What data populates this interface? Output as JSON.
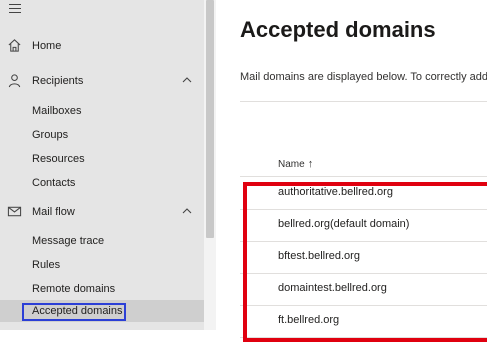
{
  "sidebar": {
    "items": [
      {
        "label": "Home",
        "icon": "home-icon"
      },
      {
        "label": "Recipients",
        "icon": "person-icon",
        "expanded": true,
        "children": [
          "Mailboxes",
          "Groups",
          "Resources",
          "Contacts"
        ]
      },
      {
        "label": "Mail flow",
        "icon": "mail-icon",
        "expanded": true,
        "children": [
          "Message trace",
          "Rules",
          "Remote domains",
          "Accepted domains"
        ]
      }
    ],
    "active": "Accepted domains"
  },
  "main": {
    "title": "Accepted domains",
    "description": "Mail domains are displayed below. To correctly add do",
    "table": {
      "columns": [
        {
          "label": "Name",
          "sort": "ascending"
        }
      ],
      "rows": [
        "authoritative.bellred.org",
        "bellred.org(default domain)",
        "bftest.bellred.org",
        "domaintest.bellred.org",
        "ft.bellred.org"
      ]
    }
  },
  "colors": {
    "sidebar_bg": "#e5e5e5",
    "active_row_bg": "#cfcfcf",
    "active_outline": "#2b3fd6",
    "annotation_box": "#e0000f"
  }
}
